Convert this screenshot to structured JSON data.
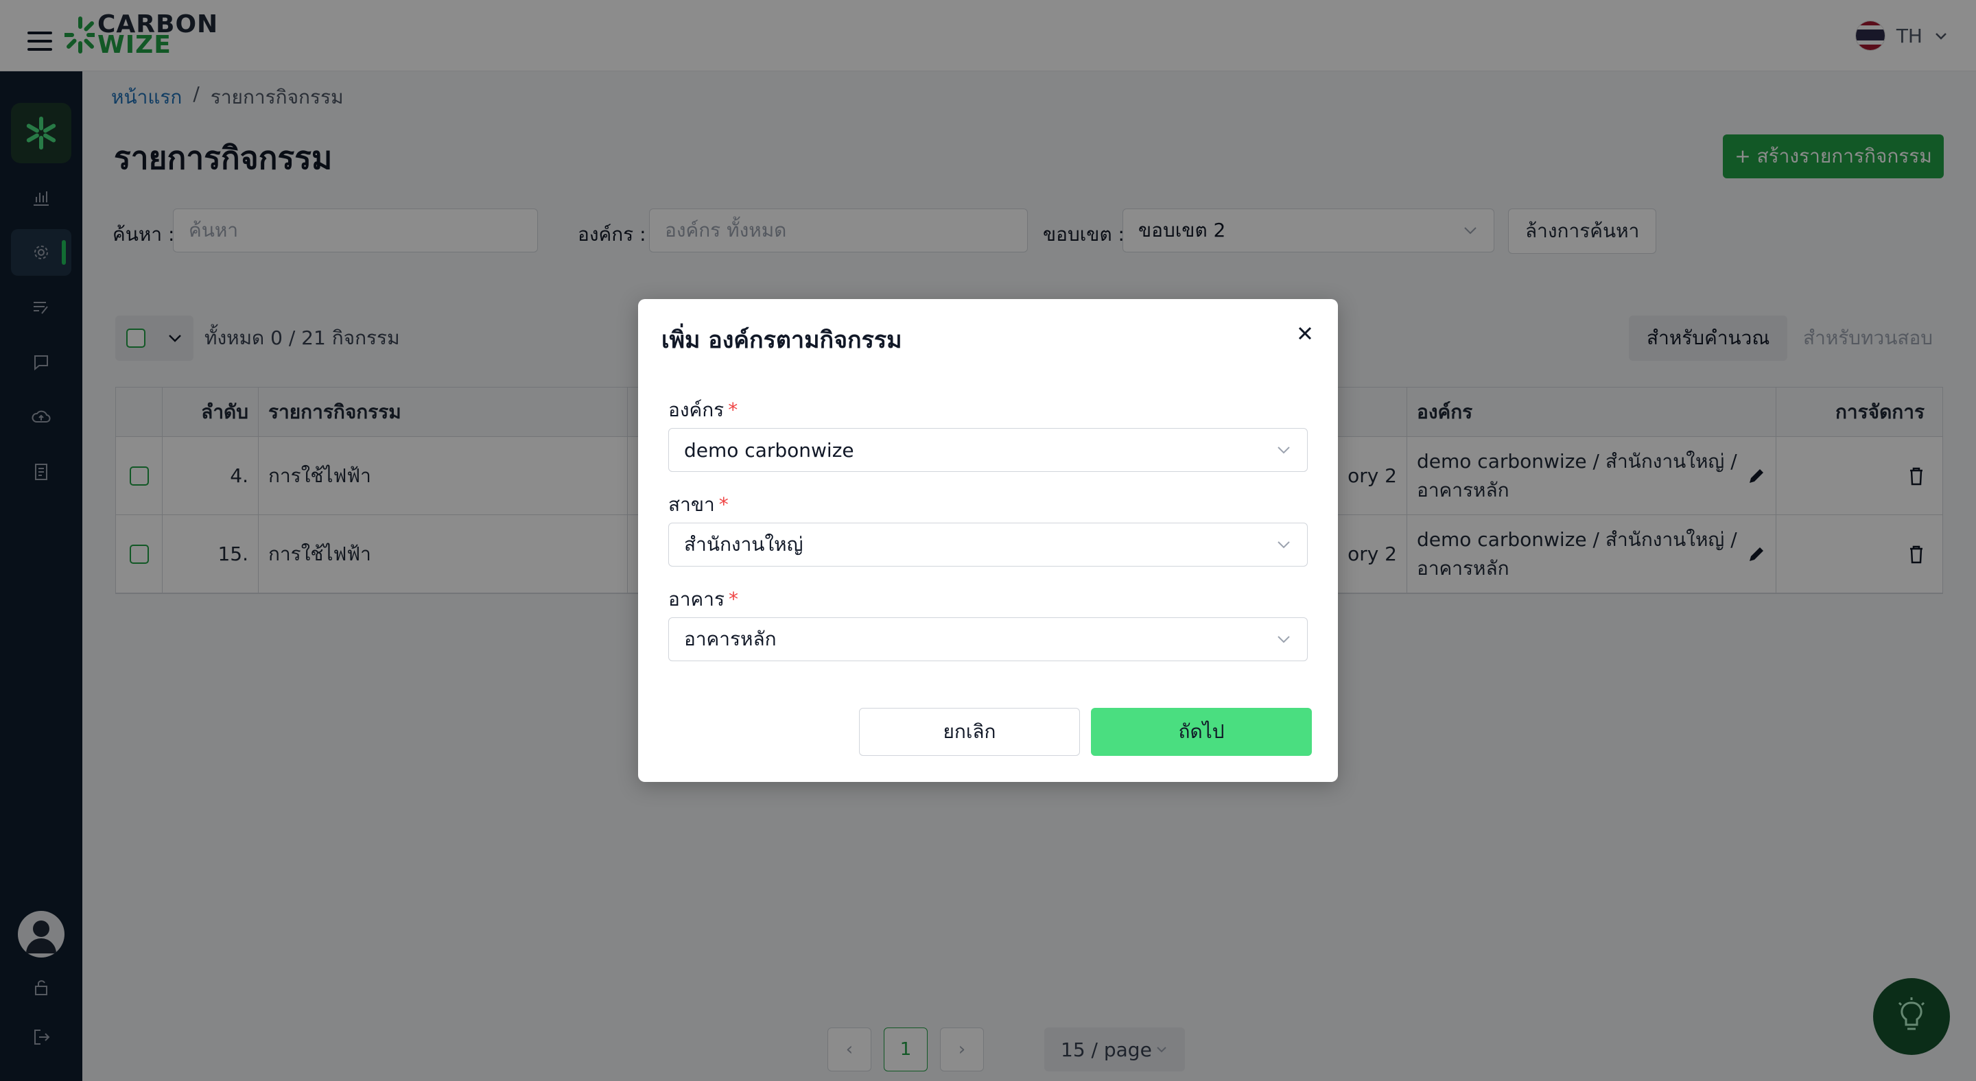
{
  "header": {
    "logo_line1": "CARBON",
    "logo_line2": "WIZE",
    "language": "TH"
  },
  "breadcrumb": {
    "home": "หน้าแรก",
    "separator": "/",
    "current": "รายการกิจกรรม"
  },
  "page": {
    "title": "รายการกิจกรรม",
    "create_button": "+ สร้างรายการกิจกรรม"
  },
  "filters": {
    "search_label": "ค้นหา :",
    "search_placeholder": "ค้นหา",
    "org_label": "องค์กร :",
    "org_placeholder": "องค์กร ทั้งหมด",
    "scope_label": "ขอบเขต :",
    "scope_value": "ขอบเขต 2",
    "clear_button": "ล้างการค้นหา"
  },
  "table": {
    "count_text": "ทั้งหมด 0 / 21 กิจกรรม",
    "tab_calc": "สำหรับคำนวณ",
    "tab_review": "สำหรับทวนสอบ",
    "headers": {
      "index": "ลำดับ",
      "activity": "รายการกิจกรรม",
      "org": "องค์กร",
      "actions": "การจัดการ"
    },
    "rows": [
      {
        "index": "4.",
        "activity": "การใช้ไฟฟ้า",
        "mid": "ory 2",
        "org_line1": "demo carbonwize / สำนักงานใหญ่ /",
        "org_line2": "อาคารหลัก"
      },
      {
        "index": "15.",
        "activity": "การใช้ไฟฟ้า",
        "mid": "ory 2",
        "org_line1": "demo carbonwize / สำนักงานใหญ่ /",
        "org_line2": "อาคารหลัก"
      }
    ]
  },
  "pagination": {
    "current_page": "1",
    "page_size": "15 / page"
  },
  "modal": {
    "title": "เพิ่ม องค์กรตามกิจกรรม",
    "org_label": "องค์กร",
    "org_value": "demo carbonwize",
    "branch_label": "สาขา",
    "branch_value": "สำนักงานใหญ่",
    "building_label": "อาคาร",
    "building_value": "อาคารหลัก",
    "required_mark": "*",
    "cancel_button": "ยกเลิก",
    "next_button": "ถัดไป"
  },
  "colors": {
    "brand_green": "#22a045",
    "next_button": "#4ade80",
    "sidebar": "#0f1e2e"
  }
}
